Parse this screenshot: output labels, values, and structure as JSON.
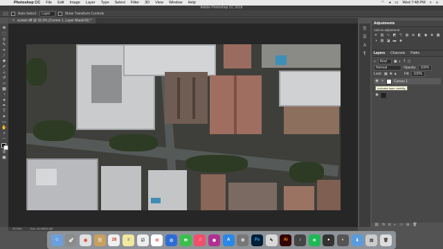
{
  "menubar": {
    "app_name": "Photoshop CC",
    "items": [
      "File",
      "Edit",
      "Image",
      "Layer",
      "Type",
      "Select",
      "Filter",
      "3D",
      "View",
      "Window",
      "Help"
    ],
    "clock": "Wed 7:48 PM"
  },
  "window": {
    "title": "Adobe Photoshop CC 2018"
  },
  "options_bar": {
    "auto_select_label": "Auto-Select:",
    "auto_select_value": "Layer",
    "show_transform_label": "Show Transform Controls"
  },
  "document": {
    "tab_title": "screen.tiff @ 33.3% (Curves 1, Layer Mask/16) *",
    "close_glyph": "×"
  },
  "status_bar": {
    "zoom": "33.33%",
    "doc_size": "Doc: 24.0M/24.0M"
  },
  "adjustments": {
    "title": "Adjustments",
    "subtitle": "Add an adjustment"
  },
  "layers_panel": {
    "tabs": [
      "Layers",
      "Channels",
      "Paths"
    ],
    "kind_label": "Kind",
    "blend_mode": "Normal",
    "opacity_label": "Opacity:",
    "opacity_value": "100%",
    "lock_label": "Lock:",
    "fill_label": "Fill:",
    "fill_value": "100%",
    "layer_name": "Curves 1",
    "tooltip": "Indicates layer visibility"
  },
  "colors": {
    "accent": "#2d7fd3",
    "ui_dark": "#535353"
  }
}
